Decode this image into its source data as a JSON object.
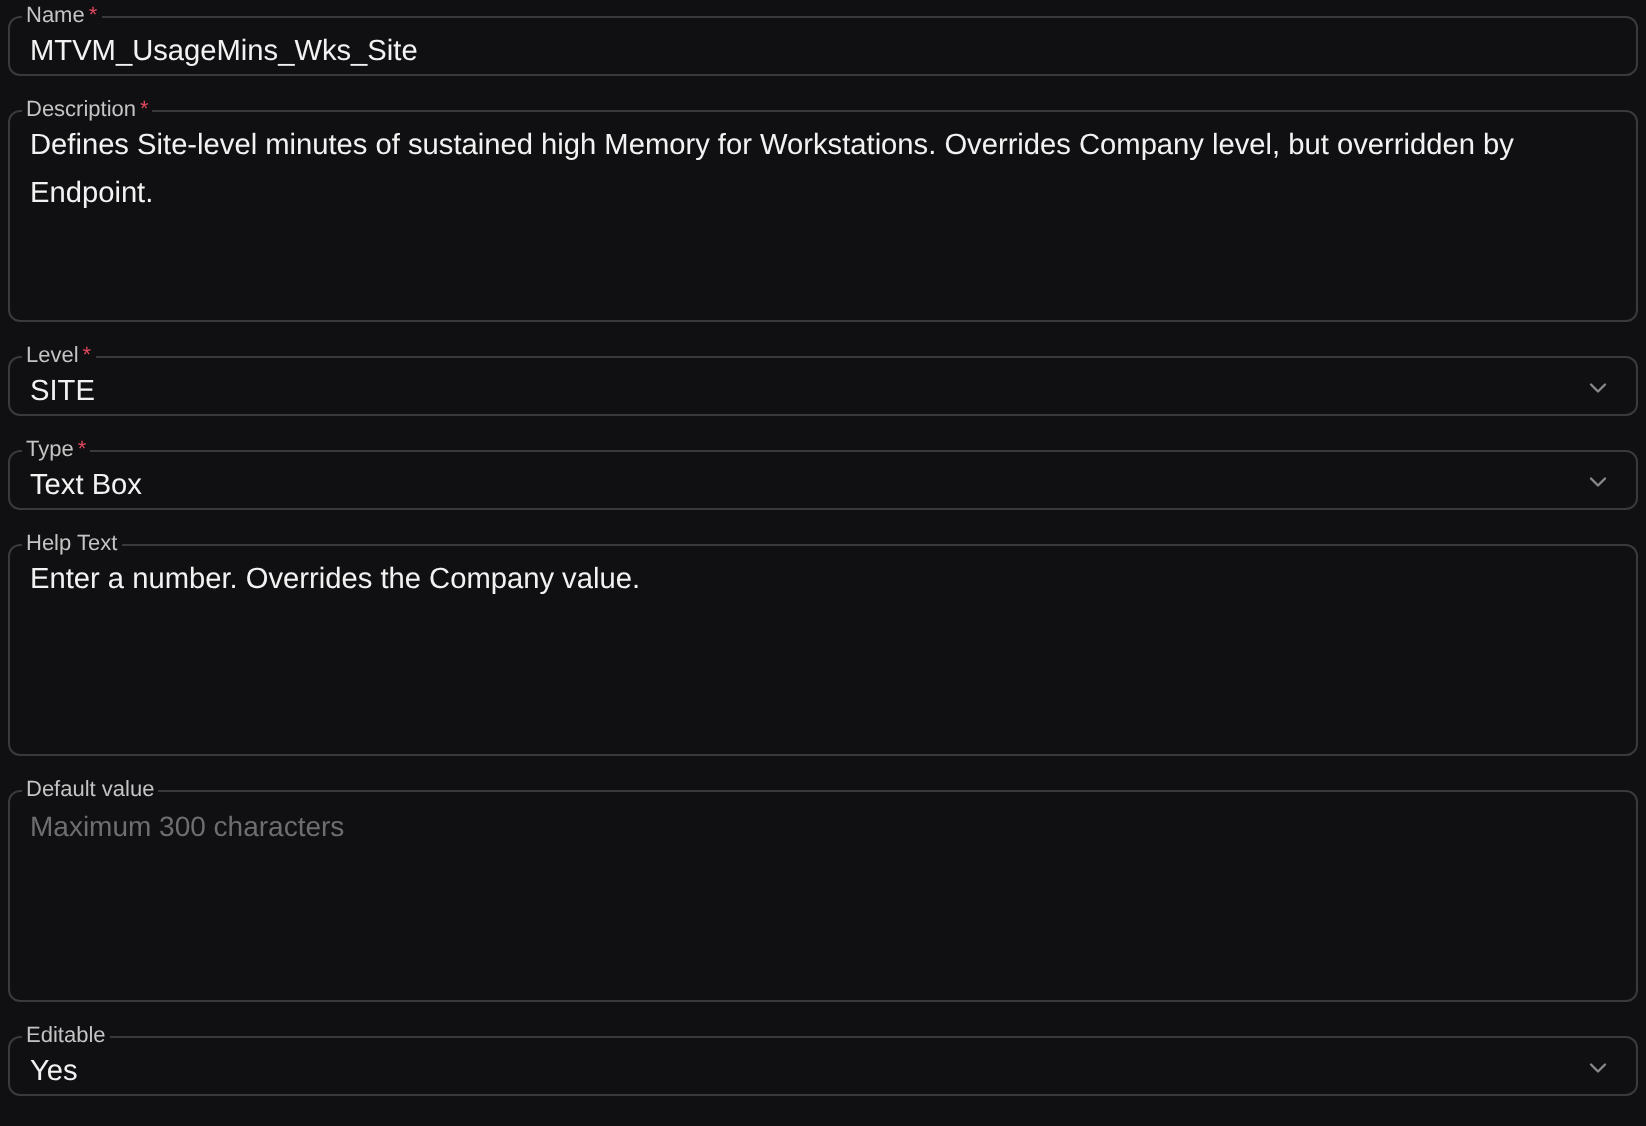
{
  "fields": [
    {
      "kind": "text",
      "label": "Name",
      "required_mark": "*",
      "value": "MTVM_UsageMins_Wks_Site"
    },
    {
      "kind": "textarea",
      "label": "Description",
      "required_mark": "*",
      "value": "Defines Site-level minutes of sustained high Memory for Workstations. Overrides Company level, but overridden by Endpoint."
    },
    {
      "kind": "select",
      "label": "Level",
      "required_mark": "*",
      "value": "SITE"
    },
    {
      "kind": "select",
      "label": "Type",
      "required_mark": "*",
      "value": "Text Box"
    },
    {
      "kind": "textarea",
      "label": "Help Text",
      "value": "Enter a number. Overrides the Company value."
    },
    {
      "kind": "textarea",
      "label": "Default value",
      "placeholder": "Maximum 300 characters"
    },
    {
      "kind": "select",
      "label": "Editable",
      "value": "Yes"
    }
  ]
}
